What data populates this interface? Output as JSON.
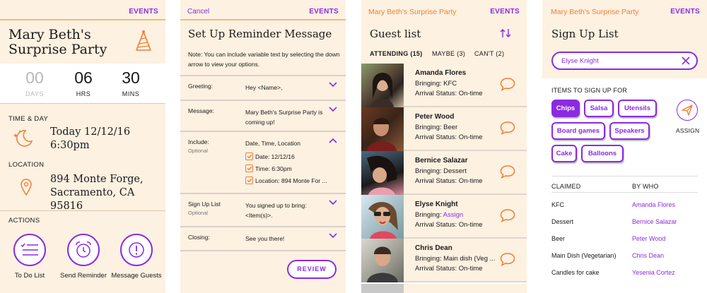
{
  "colors": {
    "accent": "#8a2be2",
    "orange": "#f07e34",
    "cream": "#fdf1e1"
  },
  "common": {
    "events_label": "EVENTS"
  },
  "event": {
    "title": "Mary Beth's Surprise Party",
    "countdown": [
      {
        "value": "00",
        "unit": "DAYS"
      },
      {
        "value": "06",
        "unit": "HRS"
      },
      {
        "value": "30",
        "unit": "MINS"
      }
    ],
    "time_label": "TIME & DAY",
    "date": "Today 12/12/16",
    "time": "6:30pm",
    "location_label": "LOCATION",
    "address_line1": "894 Monte Forge,",
    "address_line2": "Sacramento, CA 95816",
    "actions_label": "ACTIONS",
    "actions": [
      {
        "label": "To Do List",
        "icon": "checklist-icon"
      },
      {
        "label": "Send Reminder",
        "icon": "alarm-clock-icon"
      },
      {
        "label": "Message Guests",
        "icon": "exclamation-icon"
      }
    ]
  },
  "reminder": {
    "cancel": "Cancel",
    "title": "Set Up Reminder Message",
    "note": "Note: You can include variable text by selecting the down arrow to view your options.",
    "greeting_label": "Greeting:",
    "greeting_value": "Hey <Name>,",
    "message_label": "Message:",
    "message_value": "Mary Beth's Surprise Party is coming up!",
    "include_label": "Include:",
    "include_sub": "Optional",
    "include_value": "Date, Time, Location",
    "include_items": [
      "Date: 12/12/16",
      "Time: 6:30pm",
      "Location: 894 Monte For ..."
    ],
    "signup_label": "Sign Up List",
    "signup_sub": "Optional",
    "signup_value": "You signed up to bring: <Item(s)>.",
    "closing_label": "Closing:",
    "closing_value": "See you there!",
    "review": "REVIEW"
  },
  "guests": {
    "app_title": "Mary Beth's Surprise Party",
    "title": "Guest list",
    "tabs": [
      "ATTENDING (15)",
      "MAYBE (3)",
      "CAN'T (2)"
    ],
    "list": [
      {
        "name": "Amanda Flores",
        "bringing": "Bringing: KFC",
        "assign": "",
        "arrival": "Arrival Status: On-time"
      },
      {
        "name": "Peter Wood",
        "bringing": "Bringing: Beer",
        "assign": "",
        "arrival": "Arrival Status: On-time"
      },
      {
        "name": "Bernice Salazar",
        "bringing": "Bringing: Dessert",
        "assign": "",
        "arrival": "Arrival Status: On-time"
      },
      {
        "name": "Elyse Knight",
        "bringing": "Bringing:",
        "assign": "Assign",
        "arrival": "Arrival Status: On-time"
      },
      {
        "name": "Chris Dean",
        "bringing": "Bringing: Main dish (Veg ...",
        "assign": "",
        "arrival": "Arrival Status: On-time"
      }
    ]
  },
  "signup": {
    "app_title": "Mary Beth's Surprise Party",
    "title": "Sign Up List",
    "search_value": "Elyse Knight",
    "items_label": "ITEMS TO SIGN UP FOR",
    "chips": [
      "Chips",
      "Salsa",
      "Utensils",
      "Board games",
      "Speakers",
      "Cake",
      "Balloons"
    ],
    "assign": "ASSIGN",
    "claimed_label": "CLAIMED",
    "bywho_label": "BY WHO",
    "claims": [
      {
        "item": "KFC",
        "who": "Amanda Flores"
      },
      {
        "item": "Dessert",
        "who": "Bernice Salazar"
      },
      {
        "item": "Beer",
        "who": "Peter Wood"
      },
      {
        "item": "Main Dish (Vegetarian)",
        "who": "Chris Dean"
      },
      {
        "item": "Candles for cake",
        "who": "Yesenia Cortez"
      }
    ]
  }
}
